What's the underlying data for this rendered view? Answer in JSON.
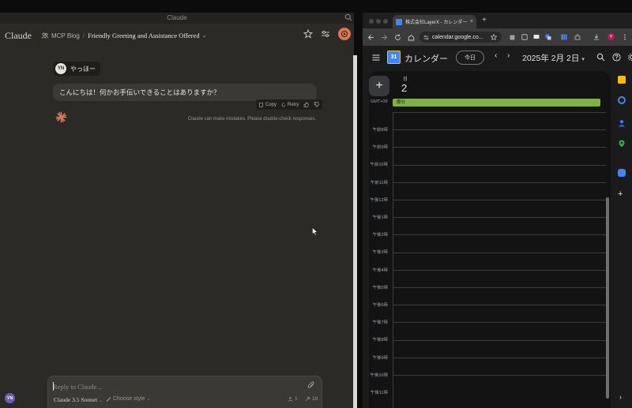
{
  "claude": {
    "window_title": "Claude",
    "logo": "Claude",
    "project": "MCP Blog",
    "separator": "/",
    "chat_title": "Friendly Greeting and Assistance Offered",
    "user_initials": "YN",
    "user_message": "やっほー",
    "assistant_message": "こんにちは！何かお手伝いできることはありますか？",
    "actions": {
      "copy": "Copy",
      "retry": "Retry"
    },
    "disclaimer": "Claude can make mistakes. Please double-check responses.",
    "composer": {
      "placeholder": "Reply to Claude...",
      "model": "Claude 3.5 Sonnet",
      "style": "Choose style",
      "count_a": "1",
      "count_b": "19"
    },
    "accent_color": "#d97757"
  },
  "chrome": {
    "tab_title": "株式会社LayerX - カレンダー",
    "tab_close": "×",
    "new_tab": "+",
    "url": "calendar.google.co...",
    "profile_initial": "Y"
  },
  "calendar": {
    "app_name": "カレンダー",
    "logo_day": "31",
    "today_button": "今日",
    "prev": "‹",
    "next": "›",
    "date_title": "2025年 2月 2日",
    "weekday": "日",
    "day_number": "2",
    "timezone": "GMT+09",
    "all_day_event": "節分",
    "event_color": "#7cb342",
    "create": "+",
    "side_plus": "+",
    "side_chevron": "›",
    "hours": [
      "午前8時",
      "午前9時",
      "午前10時",
      "午前11時",
      "午後12時",
      "午後1時",
      "午後2時",
      "午後3時",
      "午後4時",
      "午後5時",
      "午後6時",
      "午後7時",
      "午後8時",
      "午後9時",
      "午後10時",
      "午後11時"
    ]
  }
}
